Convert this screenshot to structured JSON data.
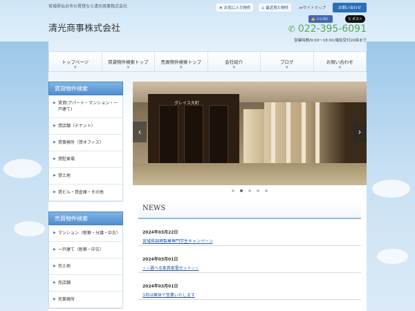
{
  "header": {
    "tagline": "宮城県仙台市の賃貸なら清光商事株式会社",
    "logo": "清光商事株式会社",
    "links": [
      {
        "icon": "star-icon",
        "label": "お気に入り物件"
      },
      {
        "icon": "house-icon",
        "label": "最近見た物件"
      },
      {
        "icon": "",
        "label": "≫サイトマップ"
      }
    ],
    "contact_button": "お問い合わせ",
    "like_button": "いいね！",
    "post_button": "ポスト",
    "phone": "022-395-6091",
    "hours": "営業時間/9:00～18:00/電話受付20時まで"
  },
  "gnav": [
    "トップページ",
    "賃貸物件検索トップ",
    "売買物件検索トップ",
    "会社紹介",
    "ブログ",
    "お問い合わせ"
  ],
  "sidebar": {
    "rental": {
      "title": "賃貸物件検索",
      "items": [
        "賃貸(アパート・マンション・一戸建て)",
        "貸店舗（テナント）",
        "貸事務所（貸オフィス）",
        "貸駐車場",
        "貸土地",
        "貸ビル・貸倉庫・その他"
      ]
    },
    "sale": {
      "title": "売買物件検索",
      "items": [
        "マンション（新築・分譲・中古）",
        "一戸建て（新築・中古）",
        "売土地",
        "売店舗",
        "売事務所"
      ]
    }
  },
  "slider": {
    "sign_text": "グレイス大町",
    "active_dot": 1,
    "dot_count": 5
  },
  "news": {
    "title": "NEWS",
    "items": [
      {
        "date": "2024年03月22日",
        "text": "宮城県調理製菓専門学生キャンペーン"
      },
      {
        "date": "2024年03月01日",
        "text": "☆☆選べる家具家電セット☆☆"
      },
      {
        "date": "2024年03月01日",
        "text": "3月は無休で営業いたします"
      }
    ]
  },
  "colors": {
    "accent": "#2a6fb8",
    "phone": "#5aa55a",
    "link": "#1d57a6"
  }
}
